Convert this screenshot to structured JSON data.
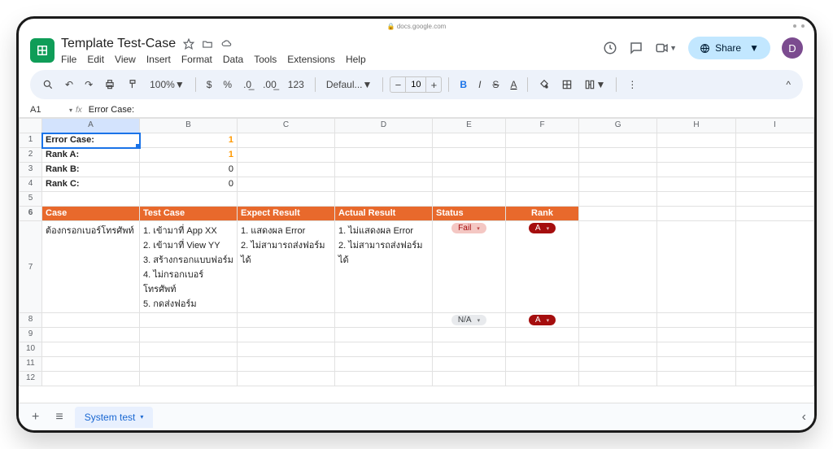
{
  "browser_url": "docs.google.com",
  "doc_title": "Template Test-Case",
  "menus": [
    "File",
    "Edit",
    "View",
    "Insert",
    "Format",
    "Data",
    "Tools",
    "Extensions",
    "Help"
  ],
  "share_label": "Share",
  "avatar_letter": "D",
  "toolbar": {
    "zoom": "100%",
    "font": "Defaul...",
    "fontsize": "10"
  },
  "namebox": {
    "cell": "A1",
    "formula": "Error Case:"
  },
  "columns": [
    "A",
    "B",
    "C",
    "D",
    "E",
    "F",
    "G",
    "H",
    "I"
  ],
  "rows": {
    "1": {
      "A": "Error Case:",
      "B": "1"
    },
    "2": {
      "A": "Rank A:",
      "B": "1"
    },
    "3": {
      "A": "Rank B:",
      "B": "0"
    },
    "4": {
      "A": "Rank C:",
      "B": "0"
    },
    "6": {
      "A": "Case",
      "B": "Test Case",
      "C": "Expect Result",
      "D": "Actual Result",
      "E": "Status",
      "F": "Rank"
    },
    "7": {
      "A": "ต้องกรอกเบอร์โทรศัพท์",
      "B": "1. เข้ามาที่ App XX\n2. เข้ามาที่ View YY\n3. สร้างกรอกแบบฟอร์ม\n4. ไม่กรอกเบอร์โทรศัพท์\n5. กดส่งฟอร์ม",
      "C": "1. แสดงผล Error\n2. ไม่สามารถส่งฟอร์มได้",
      "D": "1. ไม่แสดงผล Error\n2. ไม่สามารถส่งฟอร์มได้",
      "E": "Fail",
      "F": "A"
    },
    "8": {
      "E": "N/A",
      "F": "A"
    }
  },
  "sheet_tab": "System test"
}
